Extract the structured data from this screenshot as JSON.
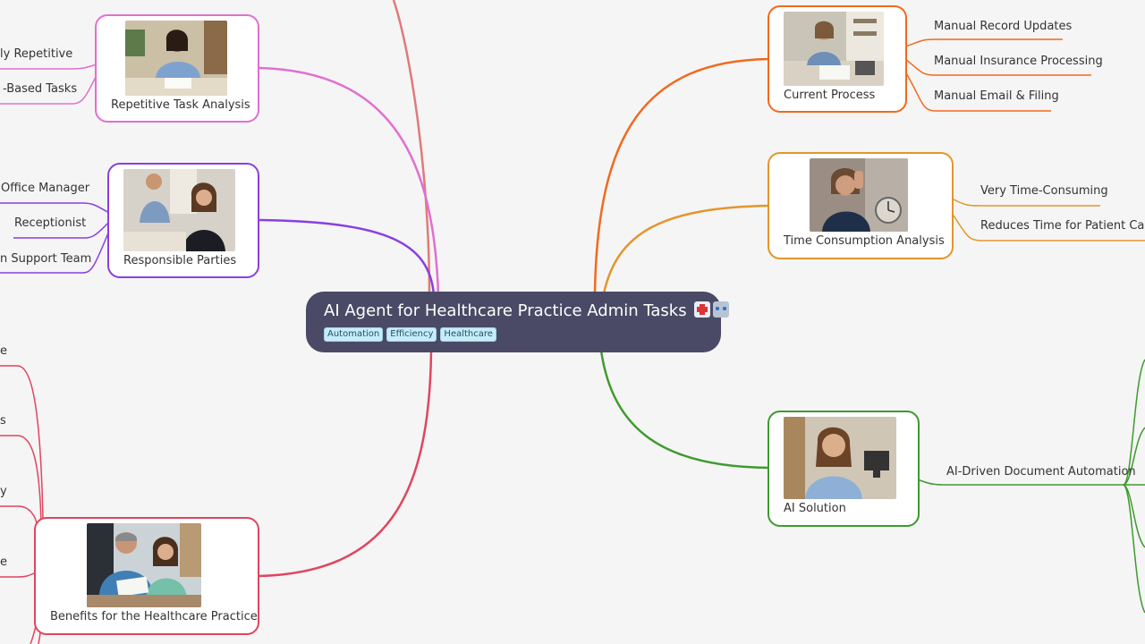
{
  "root": {
    "title": "AI Agent for Healthcare Practice Admin Tasks",
    "emoji_icons": [
      "hospital-icon",
      "robot-icon"
    ],
    "tags": [
      "Automation",
      "Efficiency",
      "Healthcare"
    ]
  },
  "right": {
    "current_process": {
      "label": "Current Process",
      "color": "#f06a1e",
      "image": "woman-doing-paperwork-photo",
      "children": [
        "Manual Record Updates",
        "Manual Insurance Processing",
        "Manual Email & Filing"
      ]
    },
    "time_consumption": {
      "label": "Time Consumption Analysis",
      "color": "#e3962b",
      "image": "stressed-woman-with-clock-photo",
      "children": [
        "Very Time-Consuming",
        "Reduces Time for Patient Care"
      ]
    },
    "ai_solution": {
      "label": "AI Solution",
      "color": "#3e9a2e",
      "image": "smiling-woman-office-photo",
      "children": [
        "AI-Driven Document Automation"
      ]
    }
  },
  "left": {
    "repetitive_task": {
      "label": "Repetitive Task Analysis",
      "color": "#e070d0",
      "image": "woman-writing-at-desk-photo",
      "children": [
        "ly Repetitive",
        "-Based Tasks"
      ]
    },
    "responsible_parties": {
      "label": "Responsible Parties",
      "color": "#8a3fe0",
      "image": "office-staff-photo",
      "children": [
        "Office Manager",
        "Receptionist",
        "n Support Team"
      ]
    },
    "benefits": {
      "label": "Benefits for the Healthcare Practice",
      "color": "#e04560",
      "image": "doctor-and-nurse-reviewing-photo",
      "children": [
        "e",
        "s",
        "y",
        "e"
      ]
    }
  }
}
